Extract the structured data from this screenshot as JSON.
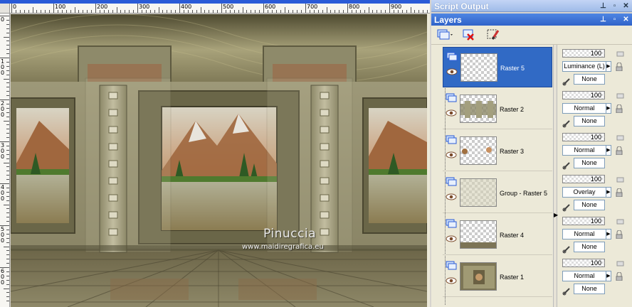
{
  "image_window": {
    "title": "",
    "ruler_top_labels": [
      "0",
      "100",
      "200",
      "300",
      "400",
      "500",
      "600",
      "700",
      "800",
      "900"
    ],
    "ruler_left_labels": [
      "0",
      "1 0 0",
      "2 0 0",
      "3 0 0",
      "4 0 0",
      "5 0 0",
      "6 0 0"
    ],
    "watermark_name": "Pinuccia",
    "watermark_url": "www.maidiregrafica.eu"
  },
  "script_output": {
    "title": "Script Output"
  },
  "layers_palette": {
    "title": "Layers",
    "layers": [
      {
        "name": "Raster 5",
        "selected": true,
        "opacity": "100",
        "blend": "Luminance (L)",
        "mask": "None"
      },
      {
        "name": "Raster 2",
        "selected": false,
        "opacity": "100",
        "blend": "Normal",
        "mask": "None"
      },
      {
        "name": "Raster 3",
        "selected": false,
        "opacity": "100",
        "blend": "Normal",
        "mask": "None"
      },
      {
        "name": "Group - Raster 5",
        "selected": false,
        "opacity": "100",
        "blend": "Overlay",
        "mask": "None"
      },
      {
        "name": "Raster 4",
        "selected": false,
        "opacity": "100",
        "blend": "Normal",
        "mask": "None"
      },
      {
        "name": "Raster 1",
        "selected": false,
        "opacity": "100",
        "blend": "Normal",
        "mask": "None"
      }
    ]
  },
  "colors": {
    "selection": "#316ac5",
    "title_active": "#3a6fd8",
    "panel_bg": "#ece9d8"
  }
}
